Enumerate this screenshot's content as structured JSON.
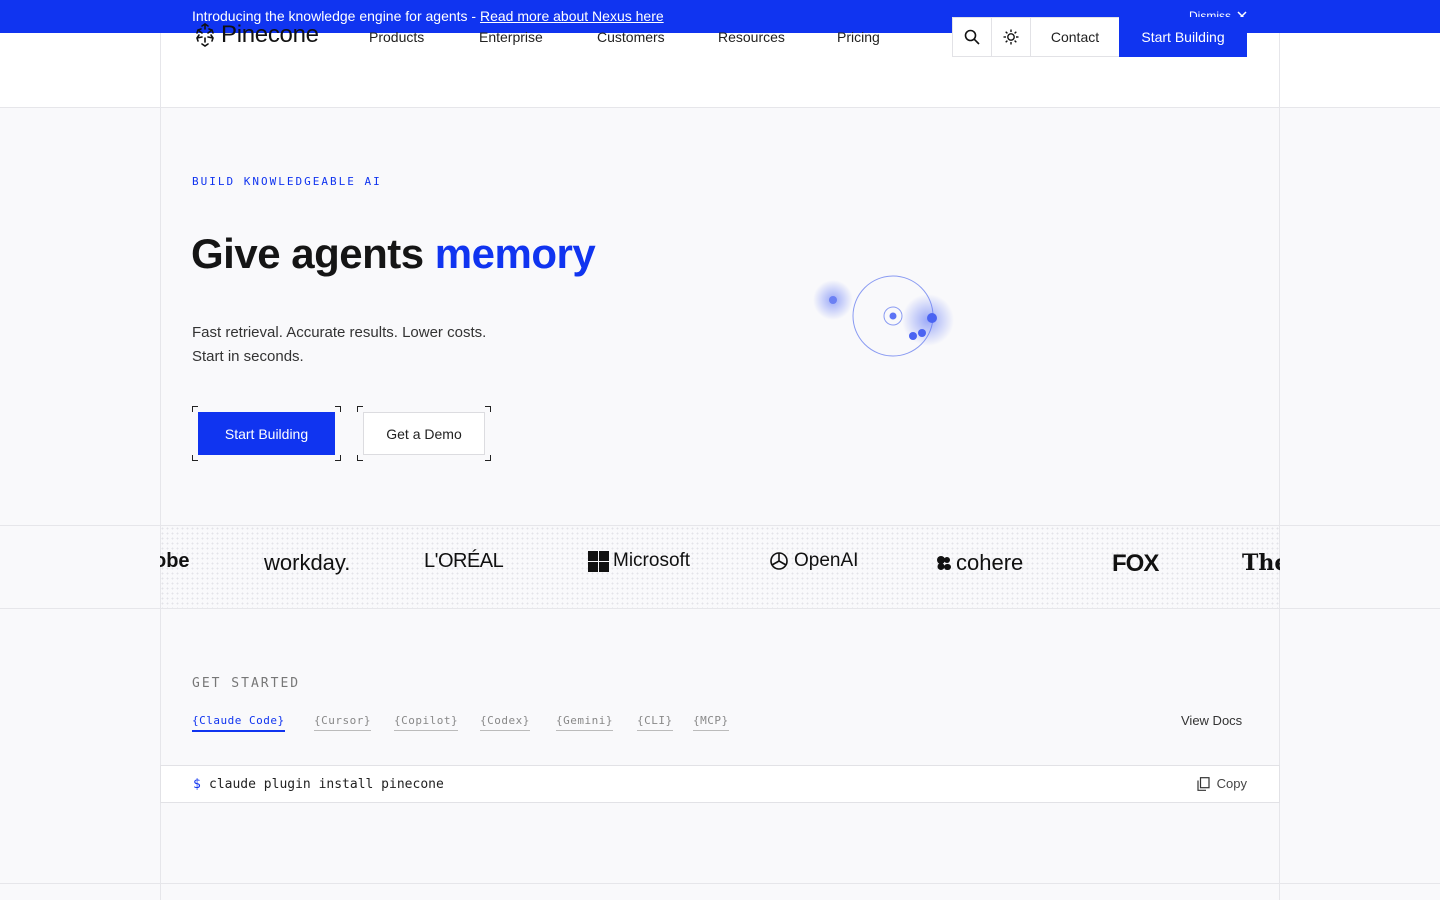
{
  "announcement": {
    "text": "Introducing the knowledge engine for agents - ",
    "link": "Read more about Nexus here",
    "dismiss": "Dismiss"
  },
  "header": {
    "logo": "Pinecone",
    "nav": [
      "Products",
      "Enterprise",
      "Customers",
      "Resources",
      "Pricing"
    ],
    "contact": "Contact",
    "cta": "Start Building",
    "icons": [
      "search-icon",
      "theme-toggle-icon"
    ]
  },
  "hero": {
    "eyebrow": "BUILD KNOWLEDGEABLE AI",
    "title_prefix": "Give agents ",
    "title_accent": "memory",
    "sub_line1": "Fast retrieval. Accurate results. Lower costs.",
    "sub_line2": "Start in seconds.",
    "primary_cta": "Start Building",
    "secondary_cta": "Get a Demo"
  },
  "logos": [
    "obe",
    "workday.",
    "L'ORÉAL",
    "Microsoft",
    "OpenAI",
    "cohere",
    "FOX",
    "The"
  ],
  "get_started": {
    "label": "GET STARTED",
    "tabs": [
      "{Claude Code}",
      "{Cursor}",
      "{Copilot}",
      "{Codex}",
      "{Gemini}",
      "{CLI}",
      "{MCP}"
    ],
    "active_tab": "{Claude Code}",
    "view_docs": "View Docs",
    "prompt": "$",
    "command": "claude plugin install pinecone",
    "copy": "Copy"
  },
  "colors": {
    "accent": "#1034f0",
    "background": "#f9f9fb",
    "border": "#e6e6ea"
  }
}
